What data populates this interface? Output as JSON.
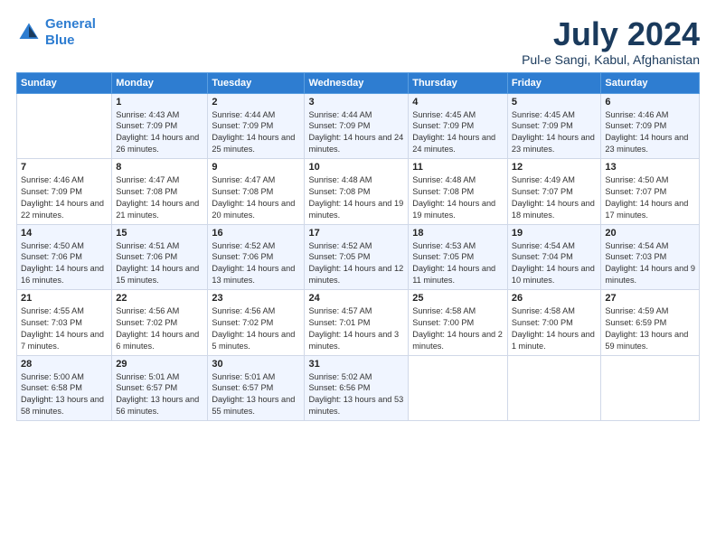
{
  "logo": {
    "line1": "General",
    "line2": "Blue"
  },
  "title": "July 2024",
  "location": "Pul-e Sangi, Kabul, Afghanistan",
  "days_of_week": [
    "Sunday",
    "Monday",
    "Tuesday",
    "Wednesday",
    "Thursday",
    "Friday",
    "Saturday"
  ],
  "weeks": [
    [
      {
        "day": "",
        "sunrise": "",
        "sunset": "",
        "daylight": ""
      },
      {
        "day": "1",
        "sunrise": "Sunrise: 4:43 AM",
        "sunset": "Sunset: 7:09 PM",
        "daylight": "Daylight: 14 hours and 26 minutes."
      },
      {
        "day": "2",
        "sunrise": "Sunrise: 4:44 AM",
        "sunset": "Sunset: 7:09 PM",
        "daylight": "Daylight: 14 hours and 25 minutes."
      },
      {
        "day": "3",
        "sunrise": "Sunrise: 4:44 AM",
        "sunset": "Sunset: 7:09 PM",
        "daylight": "Daylight: 14 hours and 24 minutes."
      },
      {
        "day": "4",
        "sunrise": "Sunrise: 4:45 AM",
        "sunset": "Sunset: 7:09 PM",
        "daylight": "Daylight: 14 hours and 24 minutes."
      },
      {
        "day": "5",
        "sunrise": "Sunrise: 4:45 AM",
        "sunset": "Sunset: 7:09 PM",
        "daylight": "Daylight: 14 hours and 23 minutes."
      },
      {
        "day": "6",
        "sunrise": "Sunrise: 4:46 AM",
        "sunset": "Sunset: 7:09 PM",
        "daylight": "Daylight: 14 hours and 23 minutes."
      }
    ],
    [
      {
        "day": "7",
        "sunrise": "Sunrise: 4:46 AM",
        "sunset": "Sunset: 7:09 PM",
        "daylight": "Daylight: 14 hours and 22 minutes."
      },
      {
        "day": "8",
        "sunrise": "Sunrise: 4:47 AM",
        "sunset": "Sunset: 7:08 PM",
        "daylight": "Daylight: 14 hours and 21 minutes."
      },
      {
        "day": "9",
        "sunrise": "Sunrise: 4:47 AM",
        "sunset": "Sunset: 7:08 PM",
        "daylight": "Daylight: 14 hours and 20 minutes."
      },
      {
        "day": "10",
        "sunrise": "Sunrise: 4:48 AM",
        "sunset": "Sunset: 7:08 PM",
        "daylight": "Daylight: 14 hours and 19 minutes."
      },
      {
        "day": "11",
        "sunrise": "Sunrise: 4:48 AM",
        "sunset": "Sunset: 7:08 PM",
        "daylight": "Daylight: 14 hours and 19 minutes."
      },
      {
        "day": "12",
        "sunrise": "Sunrise: 4:49 AM",
        "sunset": "Sunset: 7:07 PM",
        "daylight": "Daylight: 14 hours and 18 minutes."
      },
      {
        "day": "13",
        "sunrise": "Sunrise: 4:50 AM",
        "sunset": "Sunset: 7:07 PM",
        "daylight": "Daylight: 14 hours and 17 minutes."
      }
    ],
    [
      {
        "day": "14",
        "sunrise": "Sunrise: 4:50 AM",
        "sunset": "Sunset: 7:06 PM",
        "daylight": "Daylight: 14 hours and 16 minutes."
      },
      {
        "day": "15",
        "sunrise": "Sunrise: 4:51 AM",
        "sunset": "Sunset: 7:06 PM",
        "daylight": "Daylight: 14 hours and 15 minutes."
      },
      {
        "day": "16",
        "sunrise": "Sunrise: 4:52 AM",
        "sunset": "Sunset: 7:06 PM",
        "daylight": "Daylight: 14 hours and 13 minutes."
      },
      {
        "day": "17",
        "sunrise": "Sunrise: 4:52 AM",
        "sunset": "Sunset: 7:05 PM",
        "daylight": "Daylight: 14 hours and 12 minutes."
      },
      {
        "day": "18",
        "sunrise": "Sunrise: 4:53 AM",
        "sunset": "Sunset: 7:05 PM",
        "daylight": "Daylight: 14 hours and 11 minutes."
      },
      {
        "day": "19",
        "sunrise": "Sunrise: 4:54 AM",
        "sunset": "Sunset: 7:04 PM",
        "daylight": "Daylight: 14 hours and 10 minutes."
      },
      {
        "day": "20",
        "sunrise": "Sunrise: 4:54 AM",
        "sunset": "Sunset: 7:03 PM",
        "daylight": "Daylight: 14 hours and 9 minutes."
      }
    ],
    [
      {
        "day": "21",
        "sunrise": "Sunrise: 4:55 AM",
        "sunset": "Sunset: 7:03 PM",
        "daylight": "Daylight: 14 hours and 7 minutes."
      },
      {
        "day": "22",
        "sunrise": "Sunrise: 4:56 AM",
        "sunset": "Sunset: 7:02 PM",
        "daylight": "Daylight: 14 hours and 6 minutes."
      },
      {
        "day": "23",
        "sunrise": "Sunrise: 4:56 AM",
        "sunset": "Sunset: 7:02 PM",
        "daylight": "Daylight: 14 hours and 5 minutes."
      },
      {
        "day": "24",
        "sunrise": "Sunrise: 4:57 AM",
        "sunset": "Sunset: 7:01 PM",
        "daylight": "Daylight: 14 hours and 3 minutes."
      },
      {
        "day": "25",
        "sunrise": "Sunrise: 4:58 AM",
        "sunset": "Sunset: 7:00 PM",
        "daylight": "Daylight: 14 hours and 2 minutes."
      },
      {
        "day": "26",
        "sunrise": "Sunrise: 4:58 AM",
        "sunset": "Sunset: 7:00 PM",
        "daylight": "Daylight: 14 hours and 1 minute."
      },
      {
        "day": "27",
        "sunrise": "Sunrise: 4:59 AM",
        "sunset": "Sunset: 6:59 PM",
        "daylight": "Daylight: 13 hours and 59 minutes."
      }
    ],
    [
      {
        "day": "28",
        "sunrise": "Sunrise: 5:00 AM",
        "sunset": "Sunset: 6:58 PM",
        "daylight": "Daylight: 13 hours and 58 minutes."
      },
      {
        "day": "29",
        "sunrise": "Sunrise: 5:01 AM",
        "sunset": "Sunset: 6:57 PM",
        "daylight": "Daylight: 13 hours and 56 minutes."
      },
      {
        "day": "30",
        "sunrise": "Sunrise: 5:01 AM",
        "sunset": "Sunset: 6:57 PM",
        "daylight": "Daylight: 13 hours and 55 minutes."
      },
      {
        "day": "31",
        "sunrise": "Sunrise: 5:02 AM",
        "sunset": "Sunset: 6:56 PM",
        "daylight": "Daylight: 13 hours and 53 minutes."
      },
      {
        "day": "",
        "sunrise": "",
        "sunset": "",
        "daylight": ""
      },
      {
        "day": "",
        "sunrise": "",
        "sunset": "",
        "daylight": ""
      },
      {
        "day": "",
        "sunrise": "",
        "sunset": "",
        "daylight": ""
      }
    ]
  ]
}
